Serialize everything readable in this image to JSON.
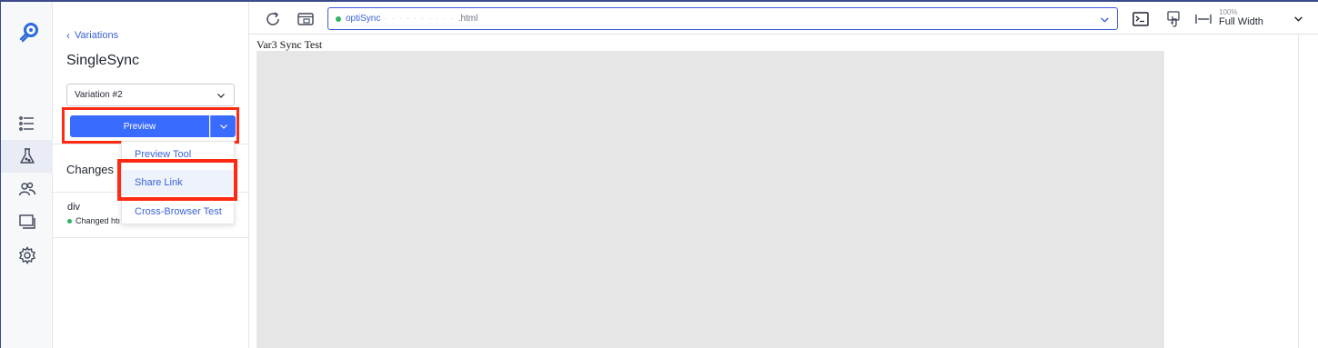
{
  "nav": {
    "logo": "optimizely-logo",
    "items": [
      {
        "icon": "list-icon",
        "active": false
      },
      {
        "icon": "flask-icon",
        "active": true
      },
      {
        "icon": "audiences-icon",
        "active": false
      },
      {
        "icon": "windows-icon",
        "active": false
      },
      {
        "icon": "gear-icon",
        "active": false
      }
    ]
  },
  "panel": {
    "back_label": "Variations",
    "experiment_title": "SingleSync",
    "variation_select": "Variation #2",
    "preview_label": "Preview",
    "changes_heading": "Changes",
    "change_element": "div",
    "change_desc": "Changed htı"
  },
  "preview_menu": {
    "items": [
      "Preview Tool",
      "Share Link",
      "Cross-Browser Test"
    ],
    "highlighted": "Share Link"
  },
  "toolbar": {
    "url_prefix": "optiSync",
    "url_blurred": "· · · · · · · · · ·",
    "url_suffix": ".html",
    "width_percent": "100%",
    "width_label": "Full Width"
  },
  "page": {
    "text": "Var3 Sync Test"
  },
  "colors": {
    "accent": "#3a6bff",
    "link": "#3a61d6",
    "annotation": "#ff2a14",
    "status_green": "#2cb566"
  }
}
